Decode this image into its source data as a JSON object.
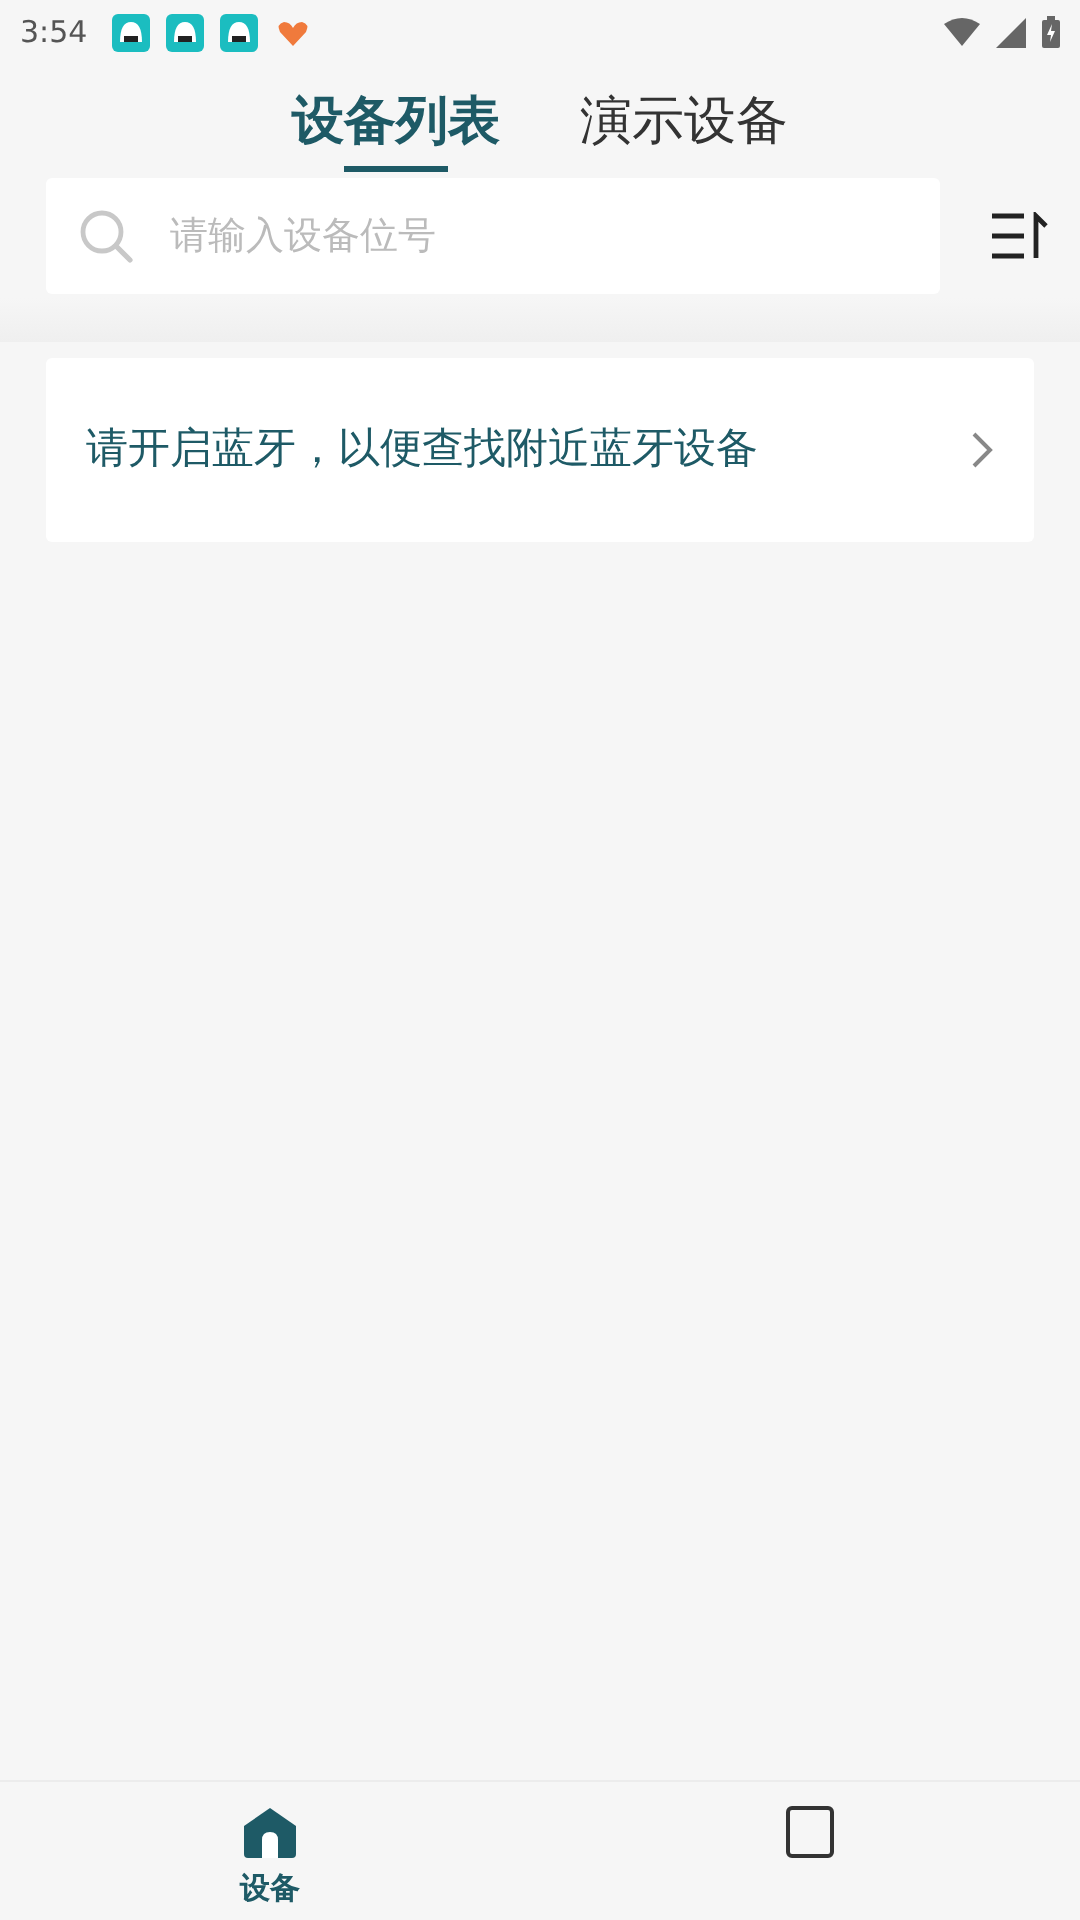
{
  "status_bar": {
    "time": "3:54"
  },
  "tabs": [
    {
      "label": "设备列表",
      "selected": true
    },
    {
      "label": "演示设备",
      "selected": false
    }
  ],
  "search": {
    "placeholder": "请输入设备位号"
  },
  "notice": {
    "text": "请开启蓝牙，以便查找附近蓝牙设备"
  },
  "bottom_nav": [
    {
      "kind": "home",
      "label": "设备",
      "selected": true
    },
    {
      "kind": "doc",
      "selected": false
    }
  ]
}
